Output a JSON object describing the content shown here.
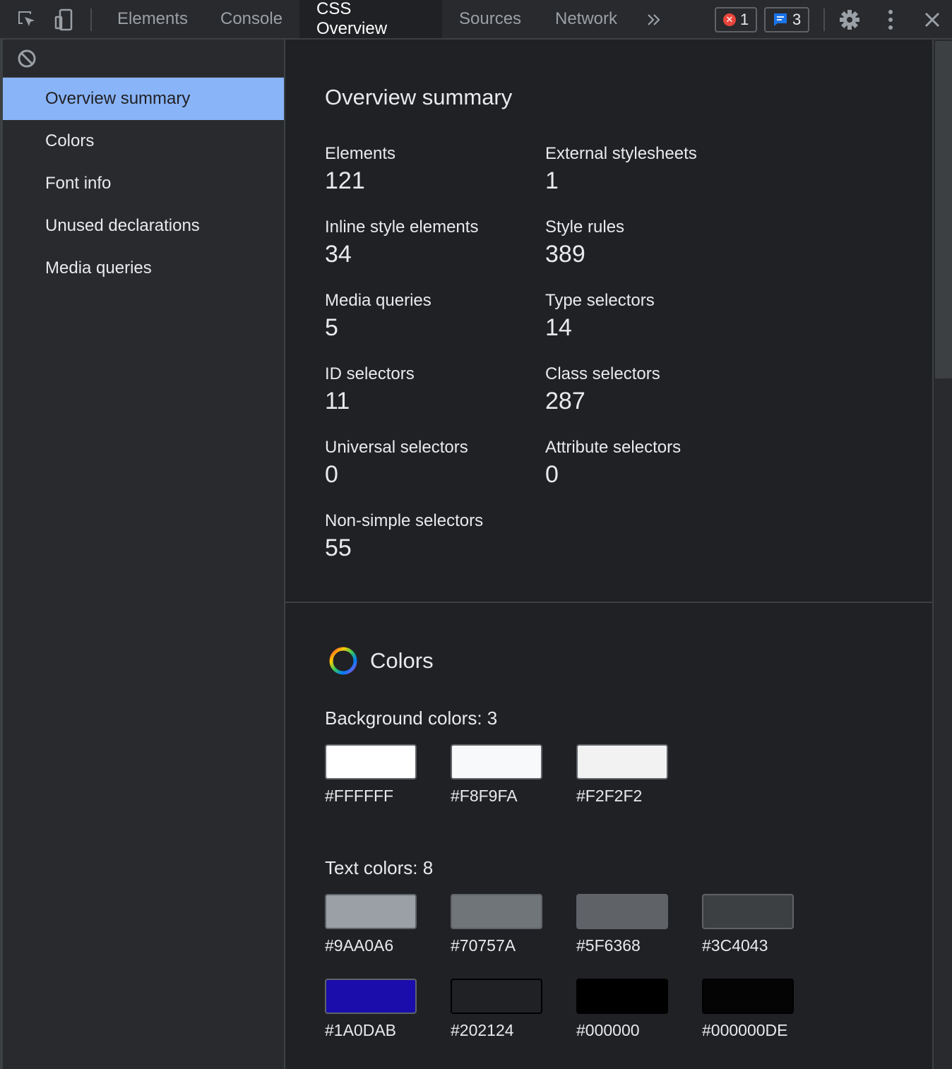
{
  "toolbar": {
    "tabs": [
      {
        "label": "Elements",
        "active": false
      },
      {
        "label": "Console",
        "active": false
      },
      {
        "label": "CSS Overview",
        "active": true
      },
      {
        "label": "Sources",
        "active": false
      },
      {
        "label": "Network",
        "active": false
      }
    ],
    "more_tabs_icon": "double-chevron-right-icon",
    "error_count": "1",
    "message_count": "3"
  },
  "sidebar": {
    "items": [
      {
        "label": "Overview summary",
        "active": true
      },
      {
        "label": "Colors",
        "active": false
      },
      {
        "label": "Font info",
        "active": false
      },
      {
        "label": "Unused declarations",
        "active": false
      },
      {
        "label": "Media queries",
        "active": false
      }
    ]
  },
  "overview": {
    "title": "Overview summary",
    "stats": [
      {
        "label": "Elements",
        "value": "121"
      },
      {
        "label": "External stylesheets",
        "value": "1"
      },
      {
        "label": "Inline style elements",
        "value": "34"
      },
      {
        "label": "Style rules",
        "value": "389"
      },
      {
        "label": "Media queries",
        "value": "5"
      },
      {
        "label": "Type selectors",
        "value": "14"
      },
      {
        "label": "ID selectors",
        "value": "11"
      },
      {
        "label": "Class selectors",
        "value": "287"
      },
      {
        "label": "Universal selectors",
        "value": "0"
      },
      {
        "label": "Attribute selectors",
        "value": "0"
      },
      {
        "label": "Non-simple selectors",
        "value": "55"
      }
    ]
  },
  "colors": {
    "title": "Colors",
    "background_title": "Background colors: 3",
    "background": [
      "#FFFFFF",
      "#F8F9FA",
      "#F2F2F2"
    ],
    "text_title": "Text colors: 8",
    "text": [
      "#9AA0A6",
      "#70757A",
      "#5F6368",
      "#3C4043",
      "#1A0DAB",
      "#202124",
      "#000000",
      "#000000DE"
    ]
  },
  "theme": {
    "accent": "#8ab4f8",
    "background": "#202124",
    "panel": "#292a2d"
  }
}
